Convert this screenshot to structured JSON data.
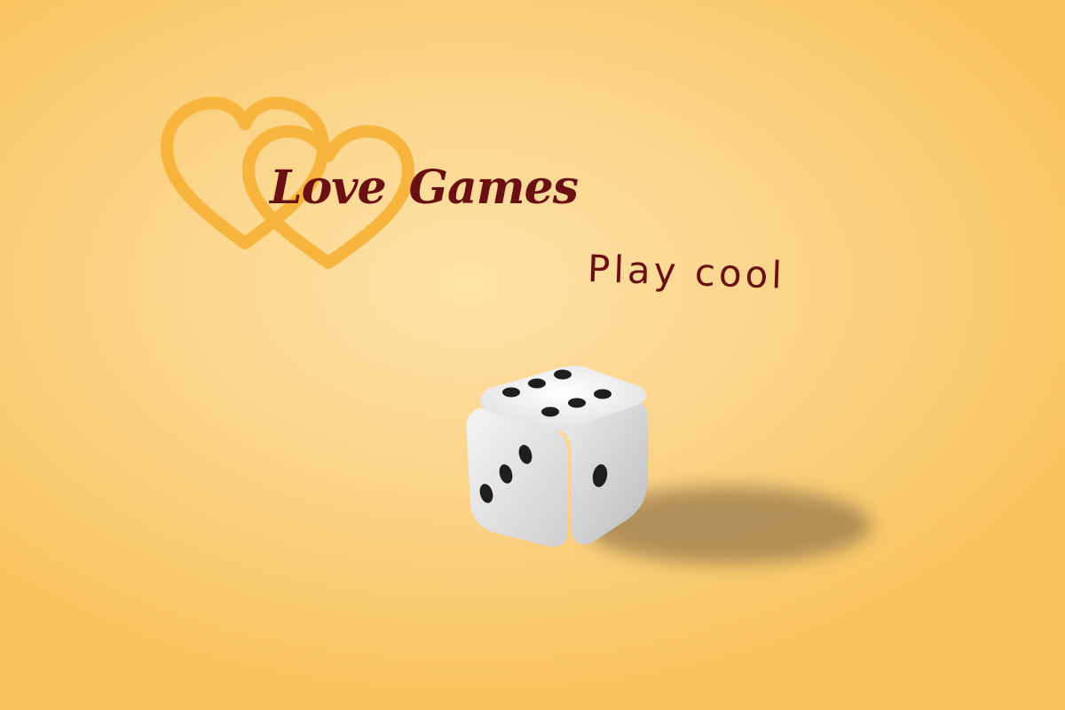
{
  "logo": {
    "word1": "Love",
    "word2": "Games",
    "hearts_icon": "double-heart-outline-icon",
    "heart_color": "#f7b53e"
  },
  "tagline": "Play cool",
  "dice": {
    "icon": "die-icon",
    "top_face_pips": 6,
    "left_face_pips": 3,
    "right_face_pips": 1
  },
  "colors": {
    "background_center": "#fde2a9",
    "background_edge": "#f9c45f",
    "text": "#6a0f12",
    "shadow": "#a58552"
  }
}
